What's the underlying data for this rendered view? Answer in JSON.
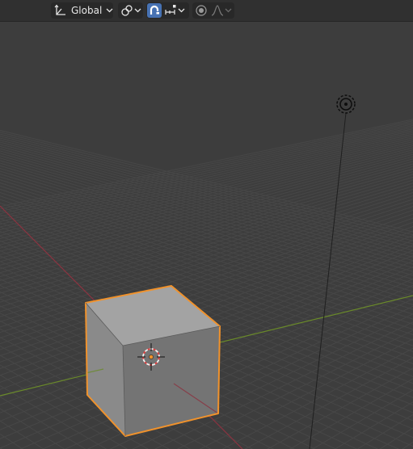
{
  "toolbar": {
    "transform_orientation": {
      "icon": "orientation-axes-icon",
      "value": "Global"
    },
    "pivot_icon": "pivot-point-icon",
    "snap": {
      "enabled": true,
      "icon": "magnet-icon",
      "target_icon": "snap-increment-icon"
    },
    "proportional_editing": {
      "enabled": false,
      "icon": "proportional-edit-icon",
      "falloff_icon": "falloff-curve-icon"
    }
  },
  "viewport": {
    "background": "#3d3d3d",
    "x_axis_color": "#8b3340",
    "y_axis_color": "#6a8a2a",
    "selection_outline": "#f0922c",
    "objects": [
      "cube",
      "light"
    ]
  }
}
